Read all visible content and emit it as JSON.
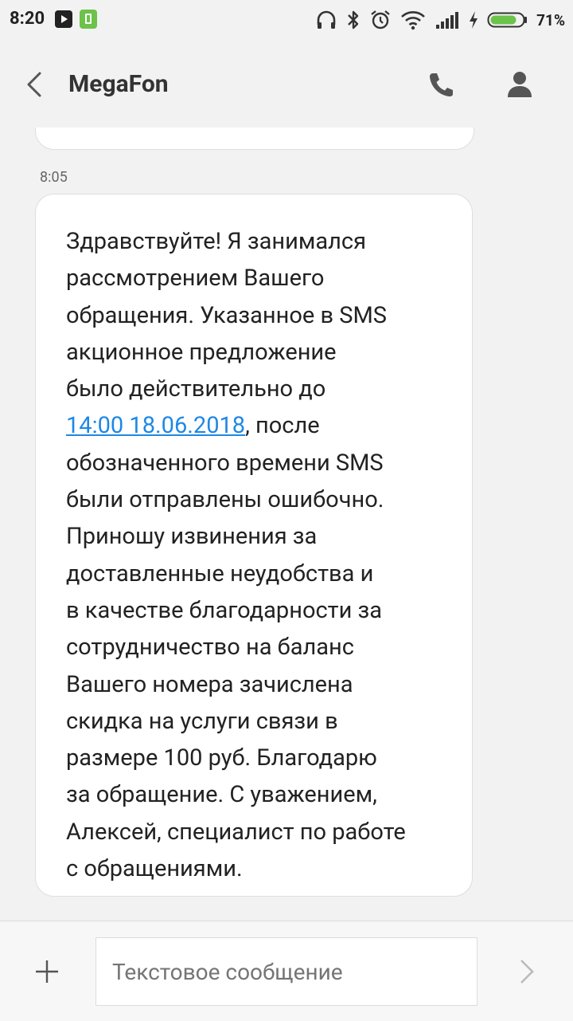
{
  "status_bar": {
    "time": "8:20",
    "battery_percent": "71%"
  },
  "header": {
    "title": "MegaFon"
  },
  "conversation": {
    "message_time": "8:05",
    "message_lines": [
      "Здравствуйте! Я занимался",
      "рассмотрением Вашего",
      "обращения. Указанное в SMS",
      "акционное предложение",
      "было действительно до",
      "14:00 18.06.2018, после",
      "обозначенного времени SMS",
      "были отправлены ошибочно.",
      "Приношу извинения за",
      "доставленные неудобства и",
      "в качестве благодарности за",
      "сотрудничество на баланс",
      "Вашего номера зачислена",
      "скидка на услуги связи в",
      "размере 100 руб. Благодарю",
      "за обращение. С уважением,",
      "Алексей, специалист по работе",
      "с обращениями."
    ],
    "link_text": "14:00 18.06.2018",
    "link_suffix": ", после"
  },
  "composer": {
    "placeholder": "Текстовое сообщение"
  },
  "colors": {
    "background": "#f2f2f2",
    "link": "#1e88e5",
    "battery": "#6cc24a"
  }
}
